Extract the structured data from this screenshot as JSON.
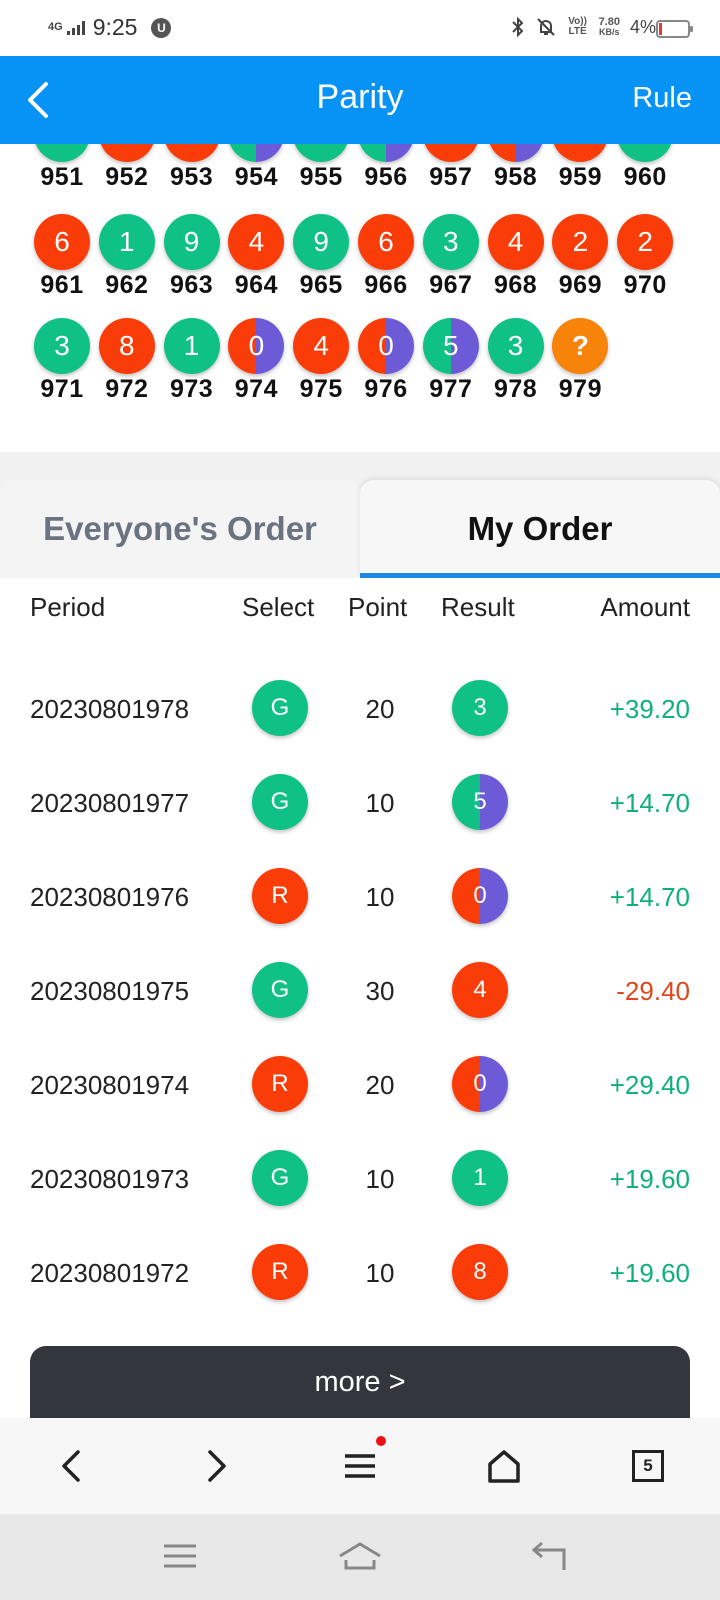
{
  "status_bar": {
    "network": "4G",
    "time": "9:25",
    "badge": "U",
    "volte": "Vo)) LTE",
    "speed_value": "7.80",
    "speed_unit": "KB/s",
    "battery": "4%"
  },
  "header": {
    "title": "Parity",
    "rule_label": "Rule"
  },
  "history": [
    {
      "period": "951",
      "number": "",
      "color": "green"
    },
    {
      "period": "952",
      "number": "",
      "color": "red"
    },
    {
      "period": "953",
      "number": "",
      "color": "red"
    },
    {
      "period": "954",
      "number": "",
      "color": "green-violet"
    },
    {
      "period": "955",
      "number": "",
      "color": "green"
    },
    {
      "period": "956",
      "number": "",
      "color": "green-violet"
    },
    {
      "period": "957",
      "number": "",
      "color": "red"
    },
    {
      "period": "958",
      "number": "",
      "color": "red-violet"
    },
    {
      "period": "959",
      "number": "",
      "color": "red"
    },
    {
      "period": "960",
      "number": "",
      "color": "green"
    },
    {
      "period": "961",
      "number": "6",
      "color": "red"
    },
    {
      "period": "962",
      "number": "1",
      "color": "green"
    },
    {
      "period": "963",
      "number": "9",
      "color": "green"
    },
    {
      "period": "964",
      "number": "4",
      "color": "red"
    },
    {
      "period": "965",
      "number": "9",
      "color": "green"
    },
    {
      "period": "966",
      "number": "6",
      "color": "red"
    },
    {
      "period": "967",
      "number": "3",
      "color": "green"
    },
    {
      "period": "968",
      "number": "4",
      "color": "red"
    },
    {
      "period": "969",
      "number": "2",
      "color": "red"
    },
    {
      "period": "970",
      "number": "2",
      "color": "red"
    },
    {
      "period": "971",
      "number": "3",
      "color": "green"
    },
    {
      "period": "972",
      "number": "8",
      "color": "red"
    },
    {
      "period": "973",
      "number": "1",
      "color": "green"
    },
    {
      "period": "974",
      "number": "0",
      "color": "red-violet"
    },
    {
      "period": "975",
      "number": "4",
      "color": "red"
    },
    {
      "period": "976",
      "number": "0",
      "color": "red-violet"
    },
    {
      "period": "977",
      "number": "5",
      "color": "green-violet"
    },
    {
      "period": "978",
      "number": "3",
      "color": "green"
    },
    {
      "period": "979",
      "number": "?",
      "color": "orange"
    }
  ],
  "tabs": {
    "everyone": "Everyone's Order",
    "mine": "My Order"
  },
  "table": {
    "headers": {
      "period": "Period",
      "select": "Select",
      "point": "Point",
      "result": "Result",
      "amount": "Amount"
    },
    "rows": [
      {
        "period": "20230801978",
        "select": "G",
        "select_color": "green",
        "point": "20",
        "result": "3",
        "result_color": "green",
        "amount": "+39.20",
        "sign": "pos"
      },
      {
        "period": "20230801977",
        "select": "G",
        "select_color": "green",
        "point": "10",
        "result": "5",
        "result_color": "green-violet",
        "amount": "+14.70",
        "sign": "pos"
      },
      {
        "period": "20230801976",
        "select": "R",
        "select_color": "red",
        "point": "10",
        "result": "0",
        "result_color": "red-violet",
        "amount": "+14.70",
        "sign": "pos"
      },
      {
        "period": "20230801975",
        "select": "G",
        "select_color": "green",
        "point": "30",
        "result": "4",
        "result_color": "red",
        "amount": "-29.40",
        "sign": "neg"
      },
      {
        "period": "20230801974",
        "select": "R",
        "select_color": "red",
        "point": "20",
        "result": "0",
        "result_color": "red-violet",
        "amount": "+29.40",
        "sign": "pos"
      },
      {
        "period": "20230801973",
        "select": "G",
        "select_color": "green",
        "point": "10",
        "result": "1",
        "result_color": "green",
        "amount": "+19.60",
        "sign": "pos"
      },
      {
        "period": "20230801972",
        "select": "R",
        "select_color": "red",
        "point": "10",
        "result": "8",
        "result_color": "red",
        "amount": "+19.60",
        "sign": "pos"
      }
    ]
  },
  "more_label": "more >",
  "browser_nav": {
    "tab_count": "5"
  },
  "colors": {
    "header_blue": "#0793f5",
    "green": "#10c185",
    "red": "#fa3c09",
    "violet": "#6d5ad6",
    "orange": "#f7830b",
    "positive_amount": "#10b07a",
    "negative_amount": "#e0451b"
  }
}
